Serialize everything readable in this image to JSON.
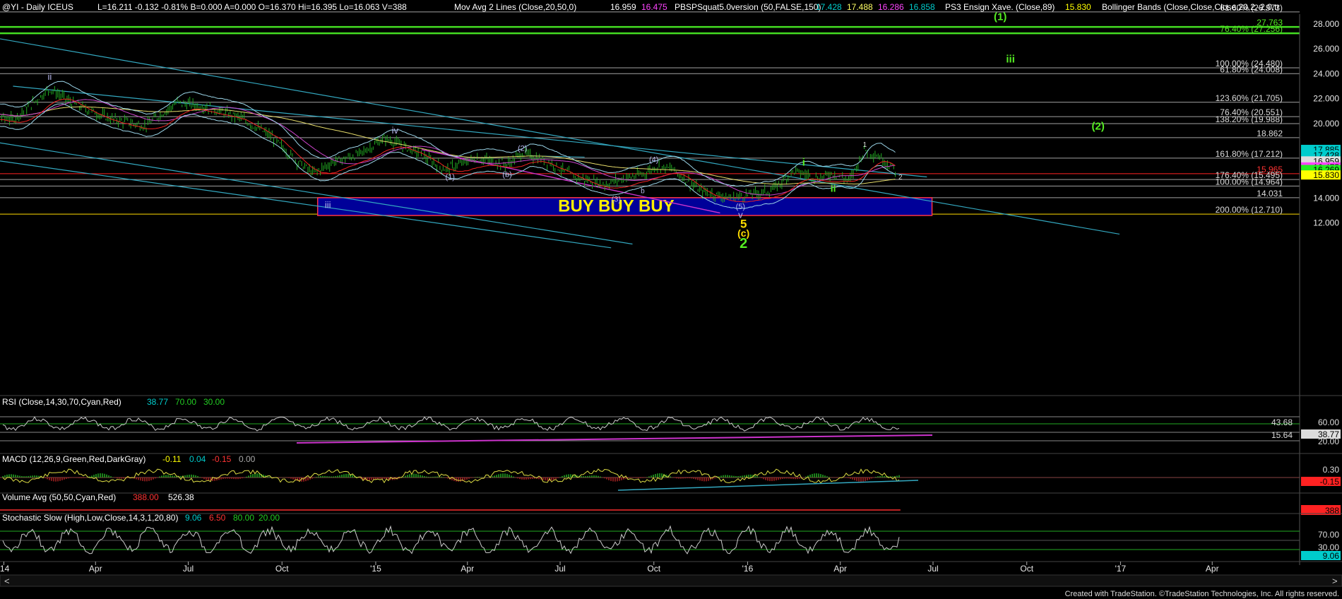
{
  "header": {
    "symbol": "@YI - Daily  ICEUS",
    "ohlc": "L=16.211  -0.132  -0.81%  B=0.000  A=0.000  O=16.370  Hi=16.395  Lo=16.063  V=388",
    "mov_avg_label": "Mov Avg 2 Lines (Close,20,50,0)",
    "mov_avg_values": [
      "16.959",
      "16.475"
    ],
    "pbsp_label": "PBSPSquat5.0version (50,FALSE,150)",
    "pbsp_values": [
      "17.428",
      "17.488",
      "16.286",
      "16.858"
    ],
    "ps3_label": "PS3 Ensign Xave. (Close,89)",
    "ps3_value": "15.830",
    "bb_label": "Bollinger Bands (Close,Close,Close,20,2,-2,0,tr"
  },
  "colors": {
    "background": "#000000",
    "price_bars": "#22aa22",
    "cyan": "#00cccc",
    "fib_lines": "#d8d8d8",
    "horizontal_green": "#44dd22",
    "support_red": "#ff2222",
    "buy_zone_fill": "#000099",
    "buy_zone_border": "#ff3344",
    "buy_text": "#ffee00",
    "channel_lines": "#33a8c0",
    "magenta": "#cc33cc",
    "wave_green": "#55ee22",
    "wave_yellow": "#ffdd00",
    "wave_lavender": "#b8b8ee",
    "axis_text": "#e8e8e8"
  },
  "chart_data": [
    {
      "type": "line",
      "title": "@YI - Daily ICEUS",
      "xlabel": "",
      "ylabel": "",
      "ylim": [
        10.3,
        29.2
      ],
      "x_tick_labels": [
        "'14",
        "Apr",
        "Jul",
        "Oct",
        "'15",
        "Apr",
        "Jul",
        "Oct",
        "'16",
        "Apr",
        "Jul",
        "Oct",
        "'17",
        "Apr"
      ],
      "y_tick_labels": [
        "28.000",
        "26.000",
        "24.000",
        "22.000",
        "20.000",
        "18.000",
        "16.000",
        "14.000",
        "12.000"
      ],
      "last_price": "16.269",
      "price_approx_points": {
        "x": [
          "2013-12-01",
          "2014-01-10",
          "2014-02-15",
          "2014-03-10",
          "2014-04-15",
          "2014-05-20",
          "2014-06-20",
          "2014-07-20",
          "2014-08-20",
          "2014-09-20",
          "2014-10-15",
          "2014-11-01",
          "2014-11-20",
          "2014-12-15",
          "2015-01-10",
          "2015-02-10",
          "2015-03-10",
          "2015-04-10",
          "2015-05-10",
          "2015-05-25",
          "2015-06-20",
          "2015-07-15",
          "2015-08-15",
          "2015-09-01",
          "2015-09-20",
          "2015-10-05",
          "2015-10-20",
          "2015-11-15",
          "2015-12-15",
          "2016-01-10",
          "2016-01-25",
          "2016-02-15",
          "2016-03-10",
          "2016-03-25",
          "2016-04-10",
          "2016-04-25",
          "2016-05-10",
          "2016-05-25"
        ],
        "y": [
          21.0,
          20.3,
          22.8,
          21.6,
          20.4,
          19.8,
          21.7,
          21.3,
          20.5,
          19.0,
          17.0,
          16.0,
          16.9,
          17.5,
          18.8,
          17.7,
          16.3,
          17.2,
          16.7,
          17.6,
          16.9,
          15.7,
          15.1,
          15.6,
          15.9,
          16.6,
          16.3,
          14.6,
          14.0,
          14.4,
          14.6,
          16.2,
          15.6,
          16.0,
          15.4,
          17.9,
          17.3,
          16.27
        ]
      },
      "horizontal_levels": [
        {
          "value": 27.763,
          "label": "27.763",
          "color": "#44dd22"
        },
        {
          "value": 27.256,
          "label": "76.40% (27.256)",
          "color": "#44dd22"
        },
        {
          "value": 28.973,
          "label": "61.60% (28.973)",
          "color": "#d8d8d8"
        },
        {
          "value": 24.48,
          "label": "100.00% (24.480)",
          "color": "#d8d8d8"
        },
        {
          "value": 24.008,
          "label": "61.80% (24.008)",
          "color": "#d8d8d8"
        },
        {
          "value": 21.705,
          "label": "123.60% (21.705)",
          "color": "#d8d8d8"
        },
        {
          "value": 20.551,
          "label": "76.40% (20.551)",
          "color": "#d8d8d8"
        },
        {
          "value": 19.988,
          "label": "138.20% (19.988)",
          "color": "#d8d8d8"
        },
        {
          "value": 18.862,
          "label": "18.862",
          "color": "#d8d8d8"
        },
        {
          "value": 17.212,
          "label": "161.80% (17.212)",
          "color": "#d8d8d8"
        },
        {
          "value": 15.965,
          "label": "15.965",
          "color": "#ff2222"
        },
        {
          "value": 15.495,
          "label": "176.40% (15.495)",
          "color": "#d8d8d8"
        },
        {
          "value": 14.964,
          "label": "100.00% (14.964)",
          "color": "#d8d8d8"
        },
        {
          "value": 14.031,
          "label": "14.031",
          "color": "#d8d8d8"
        },
        {
          "value": 12.71,
          "label": "200.00% (12.710)",
          "color": "#ffdd00"
        }
      ],
      "right_axis_values": [
        {
          "value": 17.885,
          "label": "17.885",
          "color": "#00cccc"
        },
        {
          "value": 17.428,
          "label": "17.428",
          "color": "#00cccc"
        },
        {
          "value": 16.959,
          "label": "16.959",
          "color": "#ffffff"
        },
        {
          "value": 16.475,
          "label": "16.475",
          "color": "#ff44ff"
        },
        {
          "value": 16.269,
          "label": "16.269",
          "color": "#22ee22"
        },
        {
          "value": 15.83,
          "label": "15.830",
          "color": "#ffff00"
        }
      ],
      "buy_zone": {
        "label": "BUY BUY BUY",
        "top": 14.031,
        "bottom": 12.6,
        "x_start": "2014-11-05",
        "x_end": "2016-06-30"
      },
      "wave_labels": [
        {
          "text": "(1)",
          "x": "2016-09-05",
          "y": 28.3,
          "color": "#55ee22",
          "size": 15
        },
        {
          "text": "iii",
          "x": "2016-09-15",
          "y": 24.9,
          "color": "#55ee22",
          "size": 15
        },
        {
          "text": "(2)",
          "x": "2016-12-10",
          "y": 19.5,
          "color": "#55ee22",
          "size": 15
        },
        {
          "text": "ii",
          "x": "2014-02-15",
          "y": 23.5,
          "color": "#b8b8ee",
          "size": 13
        },
        {
          "text": "i",
          "x": "2013-12-10",
          "y": 18.3,
          "color": "#b8b8ee",
          "size": 13
        },
        {
          "text": "iv",
          "x": "2015-01-20",
          "y": 19.2,
          "color": "#b8b8ee",
          "size": 13
        },
        {
          "text": "iii",
          "x": "2014-11-15",
          "y": 13.2,
          "color": "#b8b8ee",
          "size": 13
        },
        {
          "text": "(2)",
          "x": "2015-05-25",
          "y": 17.8,
          "color": "#b8b8ee",
          "size": 11
        },
        {
          "text": "(1)",
          "x": "2015-03-15",
          "y": 15.5,
          "color": "#b8b8ee",
          "size": 11
        },
        {
          "text": "(b)",
          "x": "2015-05-10",
          "y": 15.7,
          "color": "#b8b8ee",
          "size": 11
        },
        {
          "text": "(3)",
          "x": "2015-08-25",
          "y": 13.7,
          "color": "#b8b8ee",
          "size": 11
        },
        {
          "text": "(4)",
          "x": "2015-10-01",
          "y": 16.9,
          "color": "#b8b8ee",
          "size": 11
        },
        {
          "text": "b",
          "x": "2015-09-20",
          "y": 14.4,
          "color": "#b8b8ee",
          "size": 10
        },
        {
          "text": "(5)",
          "x": "2015-12-25",
          "y": 13.1,
          "color": "#b8b8ee",
          "size": 11
        },
        {
          "text": "v",
          "x": "2015-12-25",
          "y": 12.4,
          "color": "#b8b8ee",
          "size": 13
        },
        {
          "text": "5",
          "x": "2015-12-28",
          "y": 11.6,
          "color": "#ffdd00",
          "size": 17
        },
        {
          "text": "(c)",
          "x": "2015-12-28",
          "y": 10.9,
          "color": "#ffdd00",
          "size": 14
        },
        {
          "text": "2",
          "x": "2015-12-28",
          "y": 10.0,
          "color": "#55ee22",
          "size": 20
        },
        {
          "text": "i",
          "x": "2016-02-25",
          "y": 16.6,
          "color": "#55ee22",
          "size": 15
        },
        {
          "text": "ii",
          "x": "2016-03-25",
          "y": 14.5,
          "color": "#55ee22",
          "size": 14
        },
        {
          "text": "1",
          "x": "2016-04-25",
          "y": 18.1,
          "color": "#d8d8d8",
          "size": 10
        },
        {
          "text": "2",
          "x": "2016-05-30",
          "y": 15.5,
          "color": "#d8d8d8",
          "size": 10
        }
      ]
    },
    {
      "type": "line",
      "title": "RSI (Close,14,30,70,Cyan,Red)",
      "header_values": [
        "38.77",
        "70.00",
        "30.00"
      ],
      "axis_labels": [
        "60.00",
        "20.00"
      ],
      "levels": [
        "43.68",
        "15.64"
      ],
      "last_value": "38.77"
    },
    {
      "type": "bar",
      "title": "MACD (12,26,9,Green,Red,DarkGray)",
      "header_values": [
        "-0.11",
        "0.04",
        "-0.15",
        "0.00"
      ],
      "axis_labels": [
        "0.30"
      ],
      "last_value": "-0.15"
    },
    {
      "type": "bar",
      "title": "Volume Avg (50,50,Cyan,Red)",
      "header_values": [
        "388.00",
        "526.38"
      ],
      "last_value": "388"
    },
    {
      "type": "line",
      "title": "Stochastic Slow (High,Low,Close,14,3,1,20,80)",
      "header_values": [
        "9.06",
        "6.50",
        "80.00",
        "20.00"
      ],
      "axis_labels": [
        "70.00",
        "30.00"
      ],
      "last_value": "9.06"
    }
  ],
  "footer": {
    "credit": "Created with TradeStation. ©TradeStation Technologies, Inc. All rights reserved."
  }
}
